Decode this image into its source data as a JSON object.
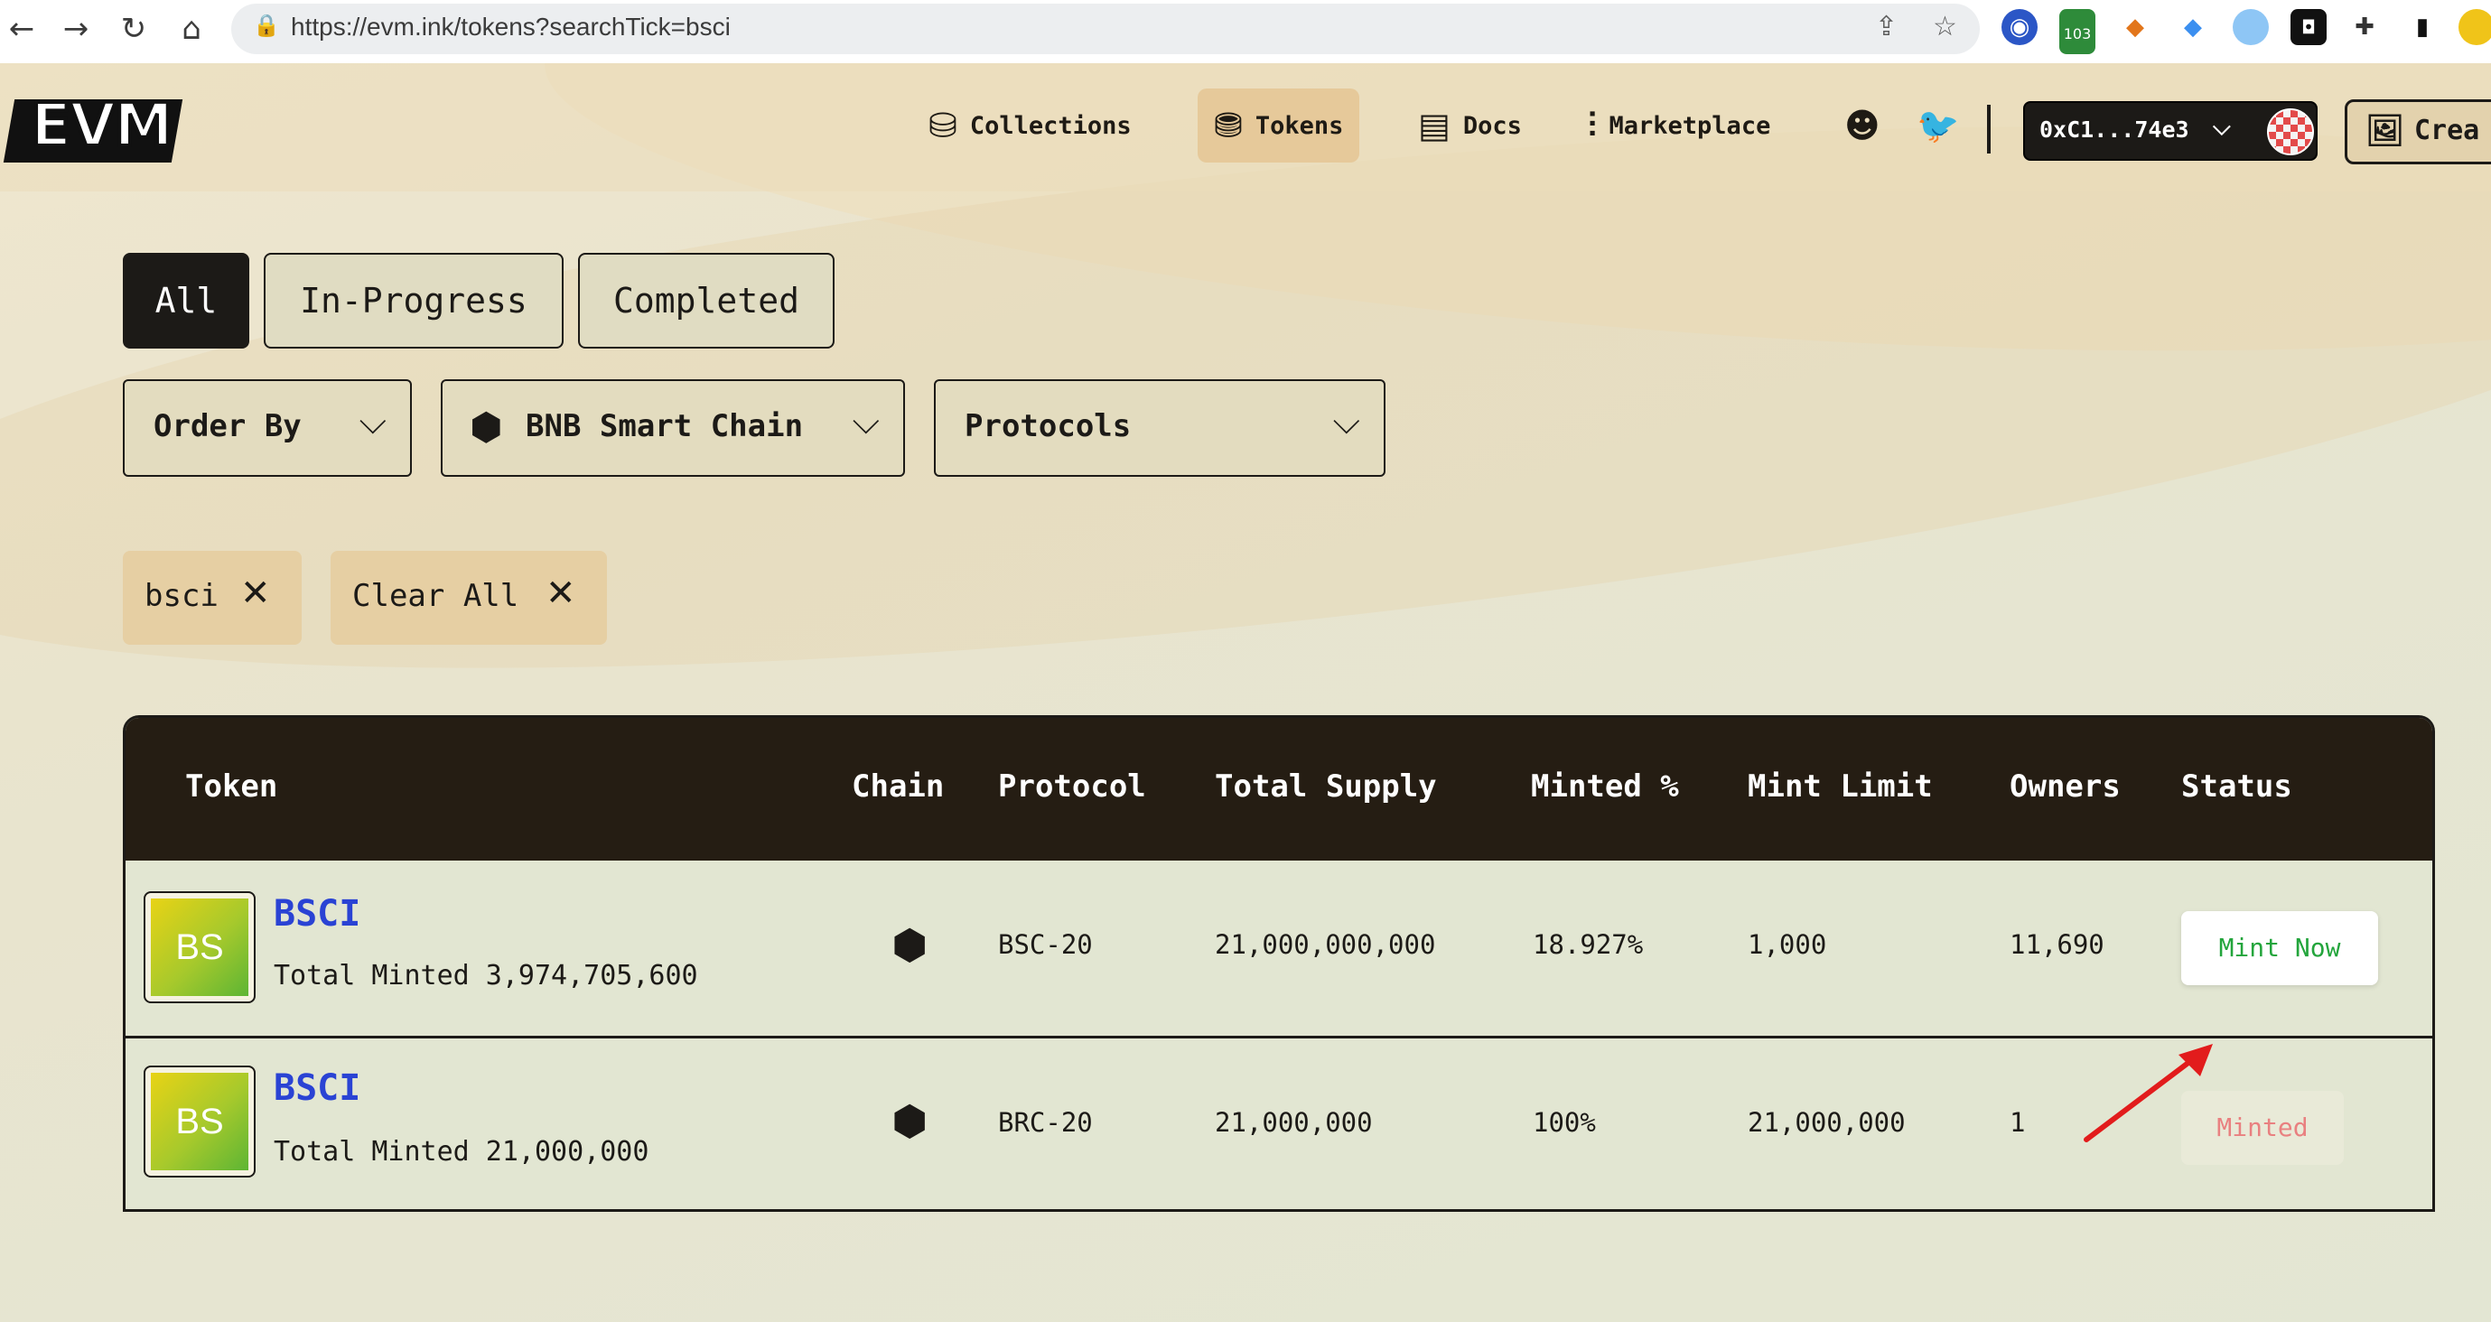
{
  "browser": {
    "url": "https://evm.ink/tokens?searchTick=bsci",
    "back_icon": "←",
    "forward_icon": "→",
    "reload_icon": "↻",
    "home_icon": "⌂",
    "share_icon": "⇪",
    "star_icon": "☆",
    "extension_badge": "103"
  },
  "logo": "EVM",
  "nav": {
    "collections": "Collections",
    "tokens": "Tokens",
    "docs": "Docs",
    "marketplace": "Marketplace"
  },
  "wallet": {
    "address": "0xC1...74e3"
  },
  "create_label": "Crea",
  "tabs": {
    "all": "All",
    "in_progress": "In-Progress",
    "completed": "Completed"
  },
  "filters": {
    "order_by": "Order By",
    "chain": "BNB Smart Chain",
    "protocols": "Protocols"
  },
  "chips": {
    "search": "bsci",
    "clear": "Clear All"
  },
  "table": {
    "headers": {
      "token": "Token",
      "chain": "Chain",
      "protocol": "Protocol",
      "total_supply": "Total Supply",
      "minted_pct": "Minted %",
      "mint_limit": "Mint Limit",
      "owners": "Owners",
      "status": "Status"
    },
    "rows": [
      {
        "icon_text": "BS",
        "name": "BSCI",
        "total_minted": "Total Minted 3,974,705,600",
        "protocol": "BSC-20",
        "total_supply": "21,000,000,000",
        "minted_pct": "18.927%",
        "mint_limit": "1,000",
        "owners": "11,690",
        "status": "Mint Now"
      },
      {
        "icon_text": "BS",
        "name": "BSCI",
        "total_minted": "Total Minted 21,000,000",
        "protocol": "BRC-20",
        "total_supply": "21,000,000",
        "minted_pct": "100%",
        "mint_limit": "21,000,000",
        "owners": "1",
        "status": "Minted"
      }
    ]
  },
  "colors": {
    "accent_green": "#23a53c",
    "minted_red": "#e98080",
    "link_blue": "#2a43d4",
    "header_dark": "#251d13"
  }
}
